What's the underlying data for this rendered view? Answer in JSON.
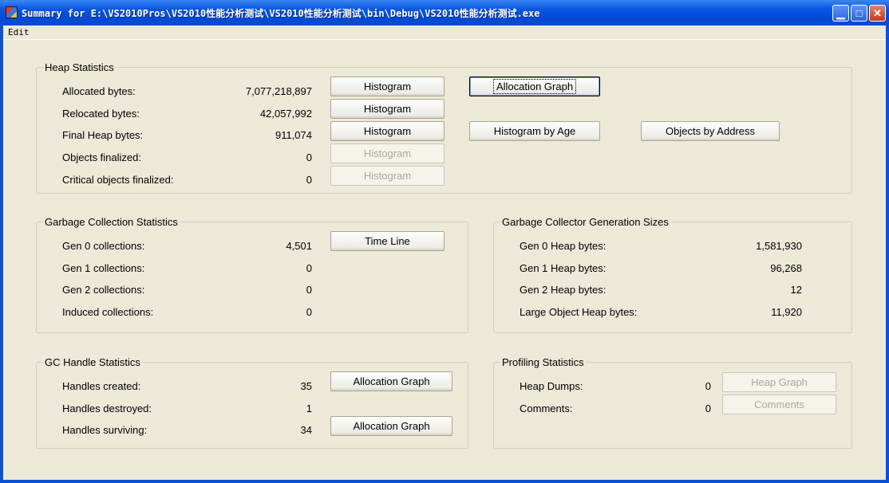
{
  "window": {
    "title": "Summary for E:\\VS2010Pros\\VS2010性能分析测试\\VS2010性能分析测试\\bin\\Debug\\VS2010性能分析测试.exe",
    "menu": [
      "Edit"
    ]
  },
  "heap": {
    "title": "Heap Statistics",
    "rows": [
      {
        "label": "Allocated bytes:",
        "value": "7,077,218,897",
        "button": "Histogram",
        "enabled": true
      },
      {
        "label": "Relocated bytes:",
        "value": "42,057,992",
        "button": "Histogram",
        "enabled": true
      },
      {
        "label": "Final Heap bytes:",
        "value": "911,074",
        "button": "Histogram",
        "enabled": true
      },
      {
        "label": "Objects finalized:",
        "value": "0",
        "button": "Histogram",
        "enabled": false
      },
      {
        "label": "Critical objects finalized:",
        "value": "0",
        "button": "Histogram",
        "enabled": false
      }
    ],
    "allocation_graph": "Allocation Graph",
    "histogram_by_age": "Histogram by Age",
    "objects_by_address": "Objects by Address"
  },
  "gc": {
    "title": "Garbage Collection Statistics",
    "rows": [
      {
        "label": "Gen 0 collections:",
        "value": "4,501"
      },
      {
        "label": "Gen 1 collections:",
        "value": "0"
      },
      {
        "label": "Gen 2 collections:",
        "value": "0"
      },
      {
        "label": "Induced collections:",
        "value": "0"
      }
    ],
    "time_line": "Time Line"
  },
  "gen_sizes": {
    "title": "Garbage Collector Generation Sizes",
    "rows": [
      {
        "label": "Gen 0 Heap bytes:",
        "value": "1,581,930"
      },
      {
        "label": "Gen 1 Heap bytes:",
        "value": "96,268"
      },
      {
        "label": "Gen 2 Heap bytes:",
        "value": "12"
      },
      {
        "label": "Large Object Heap bytes:",
        "value": "11,920"
      }
    ]
  },
  "handles": {
    "title": "GC Handle Statistics",
    "rows": [
      {
        "label": "Handles created:",
        "value": "35"
      },
      {
        "label": "Handles destroyed:",
        "value": "1"
      },
      {
        "label": "Handles surviving:",
        "value": "34"
      }
    ],
    "allocation_graph_1": "Allocation Graph",
    "allocation_graph_2": "Allocation Graph"
  },
  "profiling": {
    "title": "Profiling Statistics",
    "rows": [
      {
        "label": "Heap Dumps:",
        "value": "0",
        "button": "Heap Graph"
      },
      {
        "label": "Comments:",
        "value": "0",
        "button": "Comments"
      }
    ]
  }
}
